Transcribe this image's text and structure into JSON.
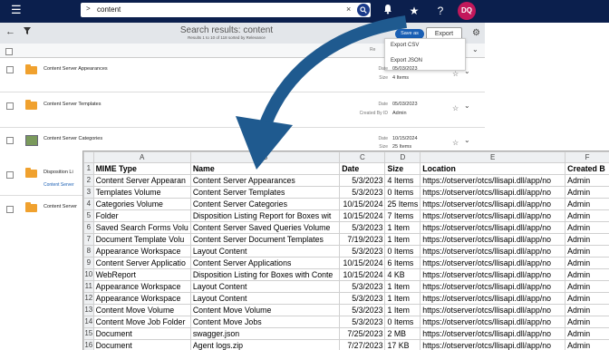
{
  "topbar": {
    "menu_icon": "hamburger-icon",
    "search_value": "content",
    "search_chevron": ">",
    "clear_icon": "×",
    "avatar_initials": "DQ",
    "icons": [
      "bell-icon",
      "star-icon",
      "help-icon"
    ],
    "help_label": "?"
  },
  "header": {
    "title": "Search results: content",
    "subtitle": "Results 1 to 10 of 118 sorted by Relevance",
    "save_as_label": "Save as",
    "export_label": "Export",
    "export_menu": [
      "Export CSV",
      "Export JSON"
    ],
    "col_relevance": "Re"
  },
  "results": [
    {
      "name": "Content Server Appearances",
      "date_label": "Date",
      "date": "05/03/2023",
      "size_label": "Size",
      "size": "4 Items"
    },
    {
      "name": "Content Server Templates",
      "date_label": "Date",
      "date": "05/03/2023",
      "size_label": "Created By ID",
      "size": "Admin"
    },
    {
      "name": "Content Server Categories",
      "date_label": "Date",
      "date": "10/15/2024",
      "size_label": "Size",
      "size": "25 Items"
    },
    {
      "name": "Disposition Li",
      "link": "Content Server"
    },
    {
      "name": "Content Server"
    }
  ],
  "sheet": {
    "columns": [
      "A",
      "B",
      "C",
      "D",
      "E",
      "F"
    ],
    "headers": [
      "MIME Type",
      "Name",
      "Date",
      "Size",
      "Location",
      "Created B"
    ],
    "rows": [
      [
        "Content Server Appearan",
        "Content Server Appearances",
        "5/3/2023",
        "4 Items",
        "https://otserver/otcs/llisapi.dll/app/no",
        "Admin"
      ],
      [
        "Templates Volume",
        "Content Server Templates",
        "5/3/2023",
        "0 Items",
        "https://otserver/otcs/llisapi.dll/app/no",
        "Admin"
      ],
      [
        "Categories Volume",
        "Content Server Categories",
        "10/15/2024",
        "25 Items",
        "https://otserver/otcs/llisapi.dll/app/no",
        "Admin"
      ],
      [
        "Folder",
        "Disposition Listing Report for Boxes wit",
        "10/15/2024",
        "7 Items",
        "https://otserver/otcs/llisapi.dll/app/no",
        "Admin"
      ],
      [
        "Saved Search Forms Volu",
        "Content Server Saved Queries Volume",
        "5/3/2023",
        "1 Item",
        "https://otserver/otcs/llisapi.dll/app/no",
        "Admin"
      ],
      [
        "Document Template Volu",
        "Content Server Document Templates",
        "7/19/2023",
        "1 Item",
        "https://otserver/otcs/llisapi.dll/app/no",
        "Admin"
      ],
      [
        "Appearance Workspace",
        "Layout Content",
        "5/3/2023",
        "0 Items",
        "https://otserver/otcs/llisapi.dll/app/no",
        "Admin"
      ],
      [
        "Content Server Applicatio",
        "Content Server Applications",
        "10/15/2024",
        "6 Items",
        "https://otserver/otcs/llisapi.dll/app/no",
        "Admin"
      ],
      [
        "WebReport",
        "Disposition Listing for Boxes with Conte",
        "10/15/2024",
        "4 KB",
        "https://otserver/otcs/llisapi.dll/app/no",
        "Admin"
      ],
      [
        "Appearance Workspace",
        "Layout Content",
        "5/3/2023",
        "1 Item",
        "https://otserver/otcs/llisapi.dll/app/no",
        "Admin"
      ],
      [
        "Appearance Workspace",
        "Layout Content",
        "5/3/2023",
        "1 Item",
        "https://otserver/otcs/llisapi.dll/app/no",
        "Admin"
      ],
      [
        "Content Move Volume",
        "Content Move Volume",
        "5/3/2023",
        "1 Item",
        "https://otserver/otcs/llisapi.dll/app/no",
        "Admin"
      ],
      [
        "Content Move Job Folder",
        "Content Move Jobs",
        "5/3/2023",
        "0 Items",
        "https://otserver/otcs/llisapi.dll/app/no",
        "Admin"
      ],
      [
        "Document",
        "swagger.json",
        "7/25/2023",
        "2 MB",
        "https://otserver/otcs/llisapi.dll/app/no",
        "Admin"
      ],
      [
        "Document",
        "Agent logs.zip",
        "7/27/2023",
        "17 KB",
        "https://otserver/otcs/llisapi.dll/app/no",
        "Admin"
      ]
    ]
  },
  "colors": {
    "topbar": "#0b1f4d",
    "arrow": "#1f5a8f",
    "avatar": "#c2185b",
    "folder": "#f0a12e"
  }
}
